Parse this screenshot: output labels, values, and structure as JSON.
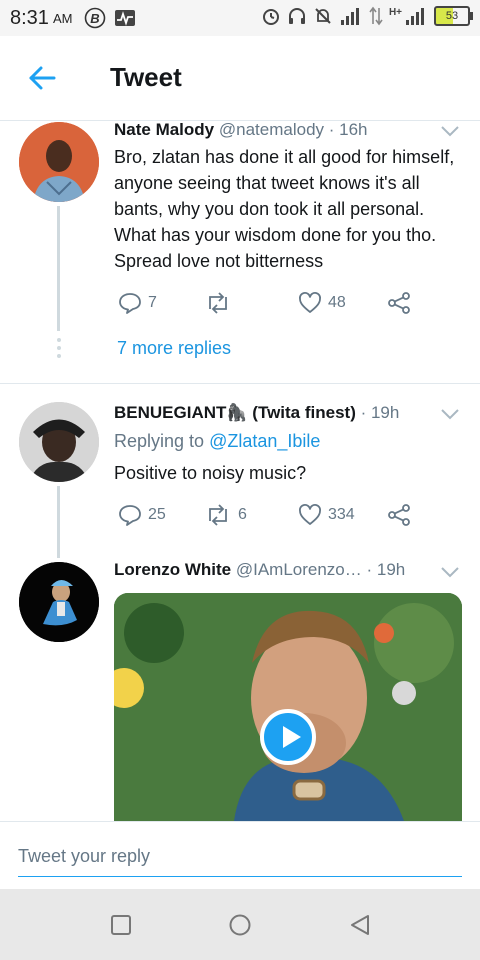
{
  "status_bar": {
    "time": "8:31",
    "ampm": "AM",
    "network_label": "H+",
    "battery": "53"
  },
  "header": {
    "title": "Tweet"
  },
  "tweets": [
    {
      "name": "Nate Malody",
      "handle": "@natemalody",
      "time": "· 16h",
      "text": "Bro, zlatan has done it all good for himself, anyone seeing that tweet knows it's all bants, why you don took it all personal. What has your wisdom done for you tho. Spread love not bitterness",
      "replies": "7",
      "retweets": "",
      "likes": "48"
    },
    {
      "name": "BENUEGIANT🦍 (Twita finest)",
      "handle": "",
      "time": "· 19h",
      "replying_prefix": "Replying to",
      "replying_to": "@Zlatan_Ibile",
      "text": "Positive to noisy music?",
      "replies": "25",
      "retweets": "6",
      "likes": "334"
    },
    {
      "name": "Lorenzo White",
      "handle": "@IAmLorenzo…",
      "time": "· 19h"
    }
  ],
  "more_replies": "7 more replies",
  "reply_bar": {
    "placeholder": "Tweet your reply"
  },
  "colors": {
    "accent": "#1da1f2",
    "link": "#1b95e0",
    "muted": "#657786"
  },
  "icons": [
    "back-arrow-icon",
    "reply-icon",
    "retweet-icon",
    "like-icon",
    "share-icon",
    "chevron-down-icon",
    "play-icon"
  ]
}
